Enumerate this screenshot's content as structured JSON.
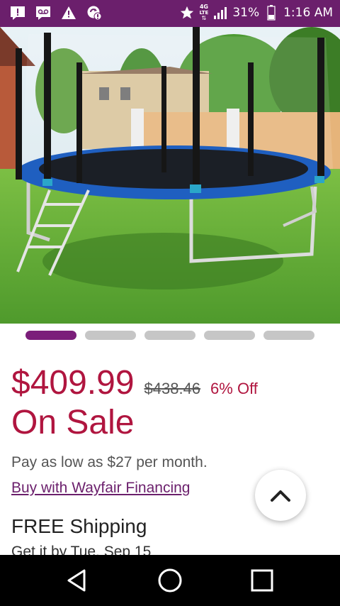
{
  "status_bar": {
    "icons_left": [
      "alert-icon",
      "voicemail-icon",
      "warning-icon",
      "sync-icon"
    ],
    "icons_right": [
      "star-icon",
      "network-4g-lte-icon",
      "signal-icon",
      "battery-icon"
    ],
    "network": "4G",
    "network_sub": "LTE",
    "battery": "31%",
    "time": "1:16 AM"
  },
  "carousel": {
    "count": 5,
    "active_index": 0
  },
  "product": {
    "price": "$409.99",
    "original_price": "$438.46",
    "discount": "6% Off",
    "sale_label": "On Sale",
    "installment_text": "Pay as low as $27 per month.",
    "financing_link": "Buy with Wayfair Financing",
    "shipping": "FREE Shipping",
    "delivery": "Get it by Tue, Sep 15"
  },
  "fab": {
    "icon": "chevron-up-icon"
  },
  "nav_bar": {
    "icons": [
      "back-icon",
      "home-icon",
      "recents-icon"
    ]
  },
  "colors": {
    "status_bar": "#6b1f6c",
    "price": "#b0153f",
    "active_dot": "#7b1e7a",
    "link": "#6b1f6c"
  }
}
